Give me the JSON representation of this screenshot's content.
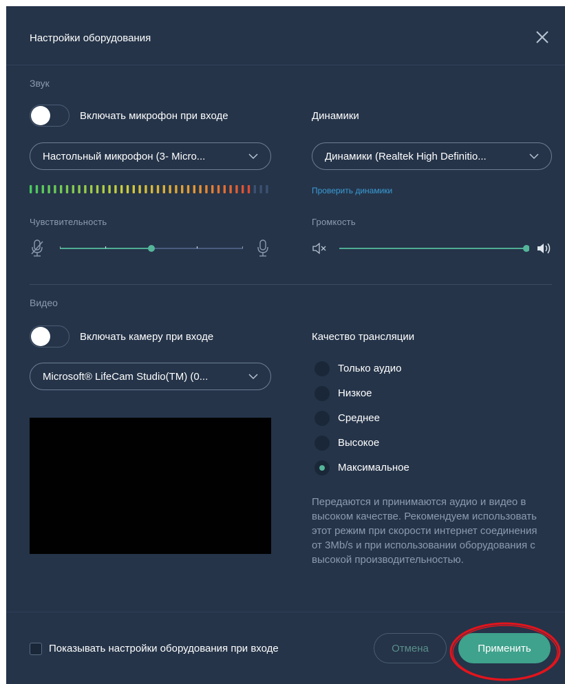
{
  "dialog": {
    "title": "Настройки оборудования",
    "close_icon": "close-icon"
  },
  "sound": {
    "section_label": "Звук",
    "mic_toggle_label": "Включать микрофон при входе",
    "mic_toggle_on": false,
    "mic_select_value": "Настольный микрофон (3- Micro...",
    "speakers_label": "Динамики",
    "speakers_select_value": "Динамики (Realtek High Definitio...",
    "test_speakers_link": "Проверить динамики",
    "mic_level": {
      "active_bars": 37,
      "total_bars": 40
    },
    "sensitivity_label": "Чувствительность",
    "sensitivity_value": 0.5,
    "volume_label": "Громкость",
    "volume_value": 1.0,
    "icons": [
      "mic-muted-icon",
      "mic-icon",
      "speaker-muted-icon",
      "speaker-loud-icon"
    ]
  },
  "video": {
    "section_label": "Видео",
    "camera_toggle_label": "Включать камеру при входе",
    "camera_toggle_on": false,
    "camera_select_value": "Microsoft® LifeCam Studio(TM) (0...",
    "quality_label": "Качество трансляции",
    "quality_options": [
      {
        "label": "Только аудио",
        "checked": false
      },
      {
        "label": "Низкое",
        "checked": false
      },
      {
        "label": "Среднее",
        "checked": false
      },
      {
        "label": "Высокое",
        "checked": false
      },
      {
        "label": "Максимальное",
        "checked": true
      }
    ],
    "quality_description": "Передаются и принимаются аудио и видео в высоком качестве. Рекомендуем использовать этот режим при скорости интернет соединения от 3Mb/s и при использовании оборудования с высокой производительностью."
  },
  "footer": {
    "show_settings_checkbox_label": "Показывать настройки оборудования при входе",
    "show_settings_checked": false,
    "cancel_label": "Отмена",
    "apply_label": "Применить"
  },
  "colors": {
    "dialog_bg": "#253449",
    "accent": "#3fa28c",
    "link": "#3a9bd5",
    "annotation": "#e3141c"
  }
}
